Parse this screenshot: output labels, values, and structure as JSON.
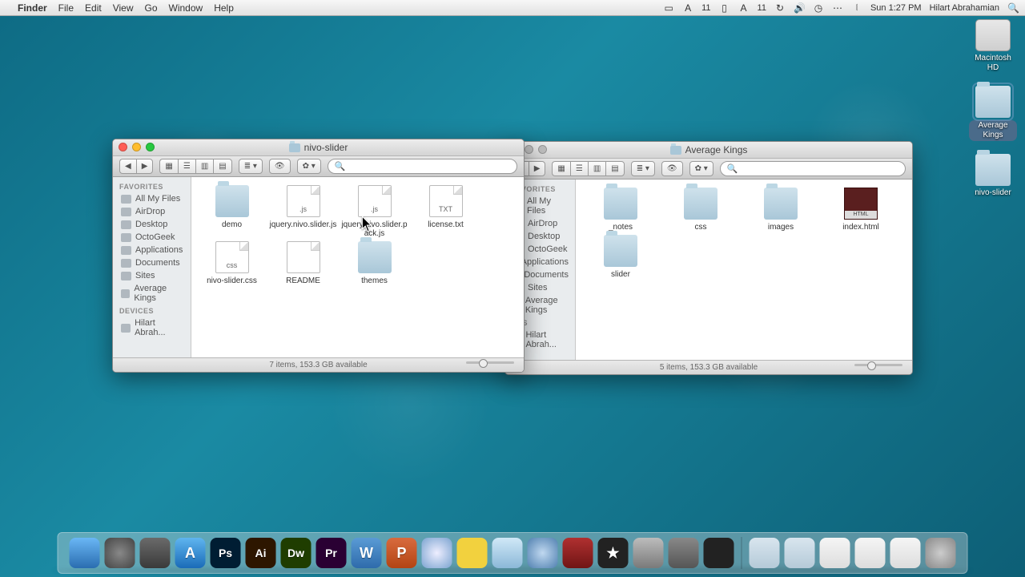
{
  "menubar": {
    "app": "Finder",
    "items": [
      "File",
      "Edit",
      "View",
      "Go",
      "Window",
      "Help"
    ],
    "status": {
      "battery1": "11",
      "battery2": "11",
      "day_time": "Sun 1:27 PM",
      "user": "Hilart Abrahamian"
    }
  },
  "desktop": {
    "icons": [
      {
        "name": "Macintosh HD",
        "type": "hd",
        "selected": false
      },
      {
        "name": "Average Kings",
        "type": "folder",
        "selected": true
      },
      {
        "name": "nivo-slider",
        "type": "folder",
        "selected": false
      }
    ]
  },
  "windows": {
    "front": {
      "title": "nivo-slider",
      "sidebar": {
        "favorites_header": "FAVORITES",
        "favorites": [
          "All My Files",
          "AirDrop",
          "Desktop",
          "OctoGeek",
          "Applications",
          "Documents",
          "Sites",
          "Average Kings"
        ],
        "devices_header": "DEVICES",
        "devices": [
          "Hilart Abrah..."
        ]
      },
      "files": [
        {
          "label": "demo",
          "type": "folder"
        },
        {
          "label": "jquery.nivo.slider.js",
          "type": "doc",
          "ext": ".js"
        },
        {
          "label": "jquery.nivo.slider.pack.js",
          "type": "doc",
          "ext": ".js"
        },
        {
          "label": "license.txt",
          "type": "doc",
          "ext": "TXT"
        },
        {
          "label": "nivo-slider.css",
          "type": "doc",
          "ext": "css"
        },
        {
          "label": "README",
          "type": "doc",
          "ext": ""
        },
        {
          "label": "themes",
          "type": "folder"
        }
      ],
      "status": "7 items, 153.3 GB available"
    },
    "back": {
      "title": "Average Kings",
      "sidebar": {
        "favorites_header": "FAVORITES",
        "favorites": [
          "All My Files",
          "AirDrop",
          "Desktop",
          "OctoGeek",
          "Applications",
          "Documents",
          "Sites",
          "Average Kings"
        ],
        "devices_header": "CES",
        "devices": [
          "Hilart Abrah..."
        ]
      },
      "files": [
        {
          "label": "_notes",
          "type": "folder"
        },
        {
          "label": "css",
          "type": "folder"
        },
        {
          "label": "images",
          "type": "folder"
        },
        {
          "label": "index.html",
          "type": "html"
        },
        {
          "label": "slider",
          "type": "folder"
        }
      ],
      "status": "5 items, 153.3 GB available"
    }
  },
  "dock": {
    "apps": [
      {
        "name": "finder",
        "bg": "linear-gradient(#6ab7f5,#2a6db0)",
        "txt": ""
      },
      {
        "name": "launchpad",
        "bg": "radial-gradient(#888,#444)",
        "txt": ""
      },
      {
        "name": "mission-control",
        "bg": "linear-gradient(#6a6a6a,#3a3a3a)",
        "txt": ""
      },
      {
        "name": "app-store",
        "bg": "linear-gradient(#5fb5ef,#1a6bb8)",
        "txt": "A"
      },
      {
        "name": "photoshop",
        "bg": "#001d33",
        "txt": "Ps"
      },
      {
        "name": "illustrator",
        "bg": "#2d1600",
        "txt": "Ai"
      },
      {
        "name": "dreamweaver",
        "bg": "#1f3d00",
        "txt": "Dw"
      },
      {
        "name": "premiere",
        "bg": "#2a0033",
        "txt": "Pr"
      },
      {
        "name": "word",
        "bg": "linear-gradient(#5a9bd5,#2e6bab)",
        "txt": "W"
      },
      {
        "name": "powerpoint",
        "bg": "linear-gradient(#d86b3e,#b34414)",
        "txt": "P"
      },
      {
        "name": "safari",
        "bg": "radial-gradient(#eef,#7aa3d0)",
        "txt": ""
      },
      {
        "name": "tweetdeck",
        "bg": "#f2d13e",
        "txt": ""
      },
      {
        "name": "mail",
        "bg": "linear-gradient(#d0e8f7,#8bb8d8)",
        "txt": ""
      },
      {
        "name": "itunes",
        "bg": "radial-gradient(#c0d8f0,#5080b0)",
        "txt": ""
      },
      {
        "name": "iphoto",
        "bg": "linear-gradient(#b03030,#701515)",
        "txt": ""
      },
      {
        "name": "imovie",
        "bg": "#222",
        "txt": "★"
      },
      {
        "name": "preferences",
        "bg": "linear-gradient(#bcbcbc,#7a7a7a)",
        "txt": ""
      },
      {
        "name": "handbrake",
        "bg": "linear-gradient(#888,#555)",
        "txt": ""
      },
      {
        "name": "final-cut",
        "bg": "#222",
        "txt": ""
      }
    ],
    "right": [
      {
        "name": "applications-stack",
        "bg": "linear-gradient(#d8e5ee,#b5cad8)"
      },
      {
        "name": "documents-stack",
        "bg": "linear-gradient(#d8e5ee,#b5cad8)"
      },
      {
        "name": "downloads-stack",
        "bg": "linear-gradient(#f5f5f5,#ddd)"
      },
      {
        "name": "desktop-stack",
        "bg": "linear-gradient(#f5f5f5,#ddd)"
      },
      {
        "name": "folder-stack",
        "bg": "linear-gradient(#f5f5f5,#ddd)"
      },
      {
        "name": "trash",
        "bg": "radial-gradient(#ccc,#888)"
      }
    ]
  }
}
